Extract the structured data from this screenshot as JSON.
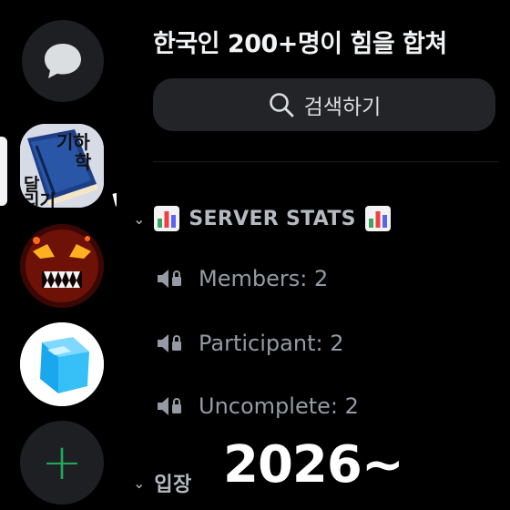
{
  "server": {
    "name": "한국인 200+명이 힘을 합쳐"
  },
  "search": {
    "label": "검색하기",
    "icon": "search-icon"
  },
  "rail": {
    "dm_icon": "chat-bubble-icon",
    "servers": [
      {
        "name": "server-icon-1",
        "image_text": [
          "기하",
          "학",
          "달",
          "리기"
        ]
      },
      {
        "name": "server-icon-2"
      },
      {
        "name": "server-icon-3"
      }
    ],
    "add_icon": "plus-icon"
  },
  "categories": [
    {
      "label": "SERVER STATS",
      "emoji": "bar-chart-icon"
    },
    {
      "label": "입장"
    }
  ],
  "channels": [
    {
      "label": "Members: 2",
      "icon": "voice-locked-icon"
    },
    {
      "label": "Participant: 2",
      "icon": "voice-locked-icon"
    },
    {
      "label": "Uncomplete: 2",
      "icon": "voice-locked-icon"
    }
  ],
  "overlay": {
    "watermark": "2026~"
  },
  "colors": {
    "background": "#000000",
    "accent_green": "#23a55a",
    "search_bg": "#232428"
  }
}
